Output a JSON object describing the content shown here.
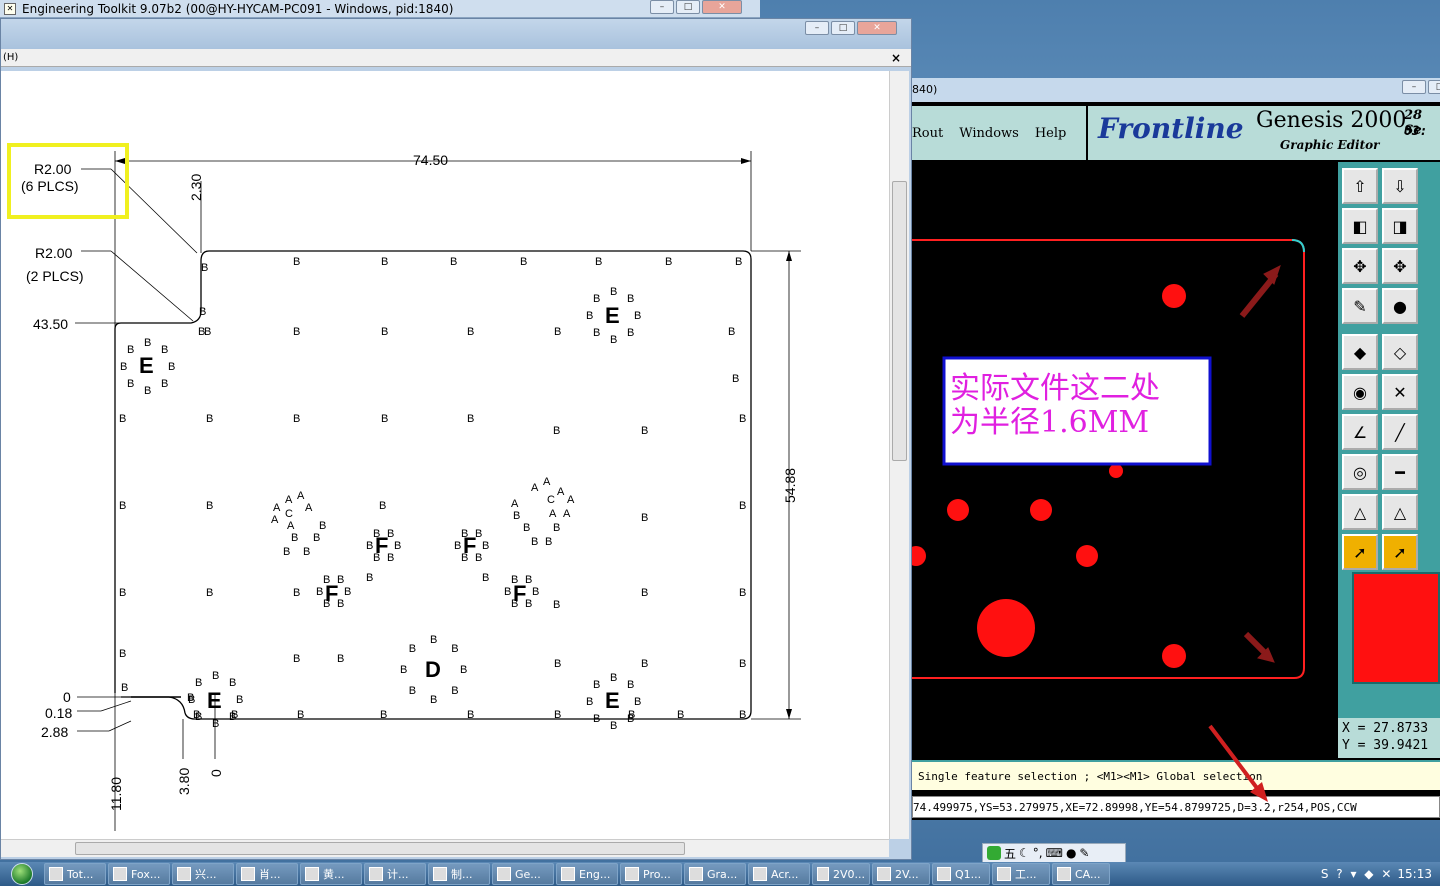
{
  "left_window": {
    "title": "Engineering Toolkit 9.07b2 (00@HY-HYCAM-PC091 - Windows, pid:1840)",
    "inner_menu_label": "(H)",
    "close_glyph": "×"
  },
  "drawing": {
    "dim_top_width": "74.50",
    "dim_right_height": "54.88",
    "dim_top_offset": "2.30",
    "callout_r1": "R2.00",
    "callout_r1_count": "(6 PLCS)",
    "callout_r2": "R2.00",
    "callout_r2_count": "(2 PLCS)",
    "dim_left_y": "43.50",
    "dim_left_0": "0",
    "dim_left_018": "0.18",
    "dim_left_288": "2.88",
    "dim_bottom_1180": "11.80",
    "dim_bottom_380": "3.80",
    "dim_bottom_0": "0",
    "cluster_labels": [
      "E",
      "E",
      "E",
      "E",
      "F",
      "F",
      "F",
      "F",
      "D",
      "C",
      "C"
    ],
    "hole_label": "B",
    "small_label": "A"
  },
  "genesis": {
    "title_fragment": "840)",
    "menu": [
      "Rout",
      "Windows",
      "Help"
    ],
    "brand": "Frontline",
    "product": "Genesis 2000",
    "subtitle": "Graphic Editor",
    "date_line1": "28 Se",
    "date_line2": "03:",
    "annotation_text_line1": "实际文件这二处",
    "annotation_text_line2": "为半径1.6MM",
    "coord_x": "X = 27.8733",
    "coord_y": "Y = 39.9421",
    "status_text": "Single feature selection ; <M1><M1> Global selection",
    "command_text": "74.499975,YS=53.279975,XE=72.89998,YE=54.8799725,D=3.2,r254,POS,CCW"
  },
  "taskbar": {
    "tasks": [
      "Tot...",
      "Fox...",
      "兴...",
      "肖...",
      "黄...",
      "计...",
      "制...",
      "Ge...",
      "Eng...",
      "Pro...",
      "Gra...",
      "Acr...",
      "2V0...",
      "2V...",
      "Q1...",
      "工...",
      "CA..."
    ],
    "time": "15:13",
    "ime_glyph": "五"
  },
  "colors": {
    "board_outline": "#ff2020",
    "annotation_border": "#1010d0",
    "annotation_text": "#e020e0",
    "highlight_box": "#f0f020",
    "arrow_dark_red": "#8b1a1a"
  }
}
